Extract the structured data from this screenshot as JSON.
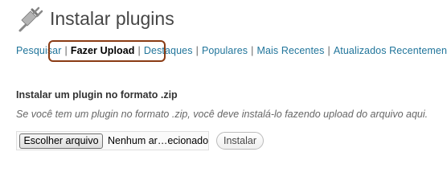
{
  "page": {
    "title": "Instalar plugins",
    "icon": "plugin-plug-icon"
  },
  "subnav": {
    "items": [
      {
        "label": "Pesquisar",
        "current": false
      },
      {
        "label": "Fazer Upload",
        "current": true
      },
      {
        "label": "Destaques",
        "current": false
      },
      {
        "label": "Populares",
        "current": false
      },
      {
        "label": "Mais Recentes",
        "current": false
      },
      {
        "label": "Atualizados Recentemente",
        "current": false
      }
    ],
    "separator": "|",
    "highlight_color": "#8a3b14"
  },
  "upload": {
    "heading": "Instalar um plugin no formato .zip",
    "description": "Se você tem um plugin no formato .zip, você deve instalá-lo fazendo upload do arquivo aqui.",
    "choose_button": "Escolher arquivo",
    "file_status": "Nenhum ar…ecionado",
    "install_button": "Instalar"
  },
  "colors": {
    "link": "#21759b",
    "title": "#464646"
  }
}
